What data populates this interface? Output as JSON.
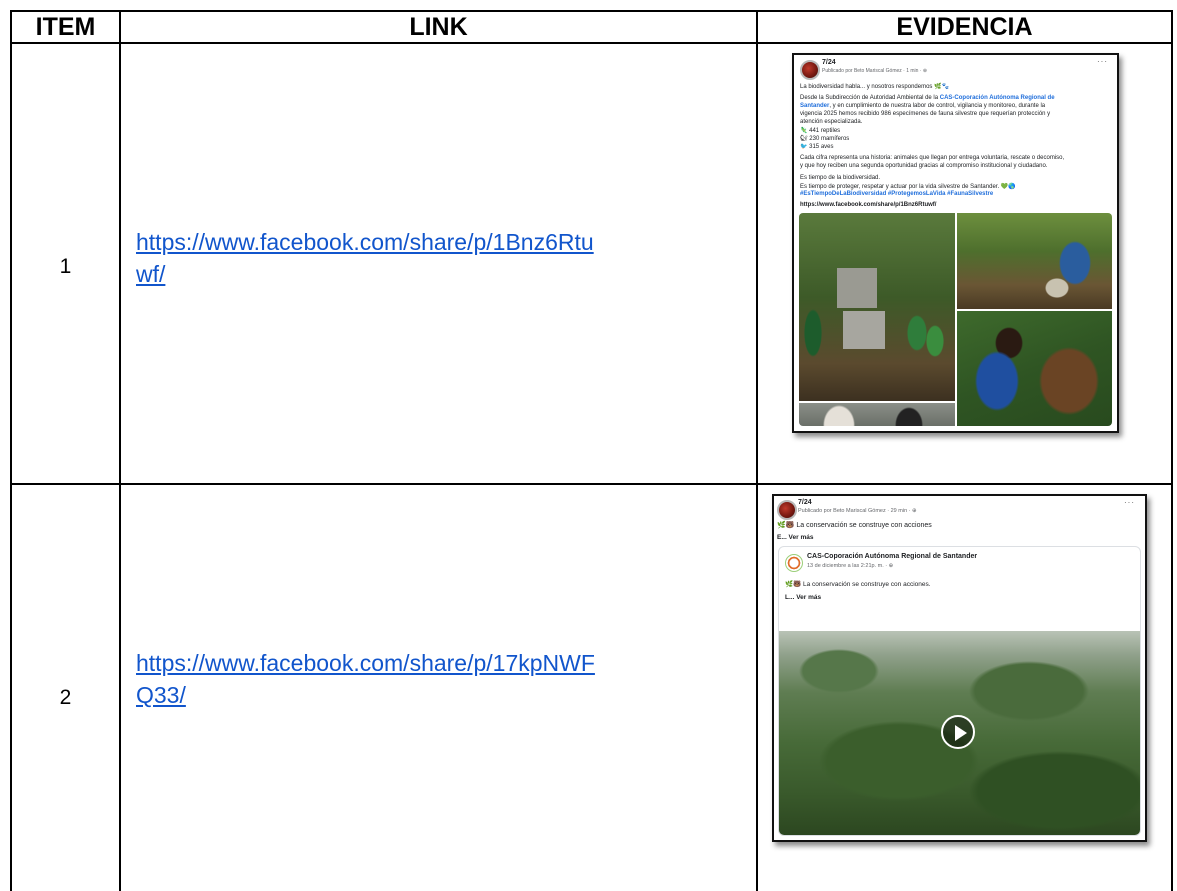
{
  "table": {
    "headers": {
      "item": "ITEM",
      "link": "LINK",
      "evidence": "EVIDENCIA"
    },
    "rows": [
      {
        "item": "1",
        "link_line1": "https://www.facebook.com/share/p/1Bnz6Rtu",
        "link_line2": "wf/"
      },
      {
        "item": "2",
        "link_line1": "https://www.facebook.com/share/p/17kpNWF",
        "link_line2": "Q33/"
      }
    ]
  },
  "post1": {
    "page_name": "7/24",
    "byline": "Publicado por Beto Mariscal Gómez · 1 min · ",
    "more": "···",
    "lines": [
      "La biodiversidad habla... y nosotros respondemos 🌿🐾",
      "Desde la Subdirección de Autoridad Ambiental de la",
      "CAS-Coporación Autónoma Regional de",
      "Santander",
      ", y en cumplimiento de nuestra labor de control, vigilancia y monitoreo, durante la",
      "vigencia 2025 hemos recibido 986 especímenes de fauna silvestre que requerían protección y",
      "atención especializada.",
      "🦎 441 reptiles",
      "🐿 230 mamíferos",
      "🐦 315 aves",
      "Cada cifra representa una historia: animales que llegan por entrega voluntaria, rescate o decomiso,",
      "y que hoy reciben una segunda oportunidad gracias al compromiso institucional y ciudadano.",
      "Es tiempo de la biodiversidad.",
      "Es tiempo de proteger, respetar y actuar por la vida silvestre de Santander. 💚🌎",
      "#EsTiempoDeLaBiodiversidad #ProtegemosLaVida #FaunaSilvestre",
      "https://www.facebook.com/share/p/1Bnz6Rtuwf/"
    ]
  },
  "post2": {
    "page_name": "7/24",
    "byline": "Publicado por Beto Mariscal Gómez · 29 min · ",
    "more": "···",
    "text": "🌿🐻 La conservación se construye con acciones",
    "see_more": "E... Ver más",
    "shared_page": "CAS-Coporación Autónoma Regional de Santander",
    "shared_date": "13 de diciembre a las 2:21p. m. · ",
    "shared_text": "🌿🐻 La conservación se construye con acciones.",
    "shared_see_more": "L... Ver más",
    "play_icon": "play-icon"
  },
  "colors": {
    "link": "#1155cc",
    "fb_blue": "#216fdb",
    "forest": "#3f6a2a"
  }
}
